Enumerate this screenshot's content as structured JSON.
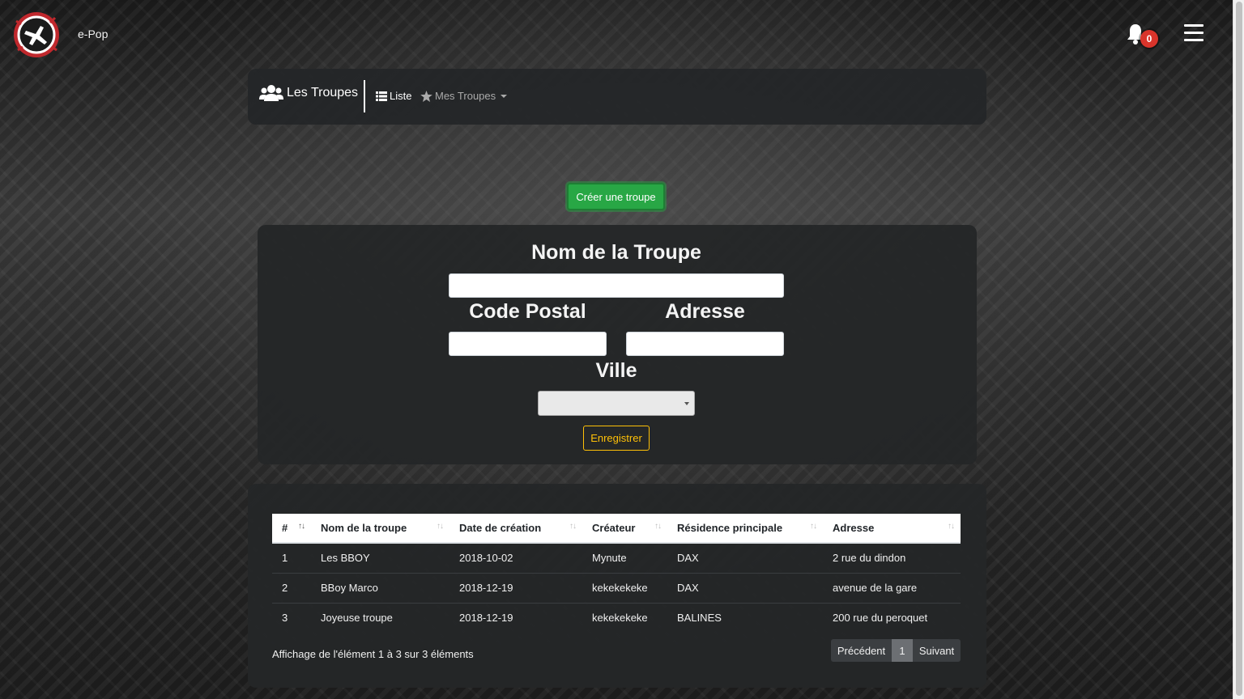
{
  "app": {
    "brand": "e-Pop",
    "notifications_count": "0"
  },
  "nav": {
    "title": "Les Troupes",
    "liste_label": "Liste",
    "mes_troupes_label": "Mes Troupes"
  },
  "actions": {
    "create_label": "Créer une troupe"
  },
  "form": {
    "nom_label": "Nom de la Troupe",
    "nom_value": "",
    "code_postal_label": "Code Postal",
    "code_postal_value": "",
    "adresse_label": "Adresse",
    "adresse_value": "",
    "ville_label": "Ville",
    "ville_value": "",
    "save_label": "Enregistrer"
  },
  "table": {
    "columns": [
      "#",
      "Nom de la troupe",
      "Date de création",
      "Créateur",
      "Résidence principale",
      "Adresse"
    ],
    "rows": [
      [
        "1",
        "Les BBOY",
        "2018-10-02",
        "Mynute",
        "DAX",
        "2 rue du dindon"
      ],
      [
        "2",
        "BBoy Marco",
        "2018-12-19",
        "kekekekeke",
        "DAX",
        "avenue de la gare"
      ],
      [
        "3",
        "Joyeuse troupe",
        "2018-12-19",
        "kekekekeke",
        "BALINES",
        "200 rue du peroquet"
      ]
    ],
    "info": "Affichage de l'élément 1 à 3 sur 3 éléments",
    "pagination": {
      "prev": "Précédent",
      "current": "1",
      "next": "Suivant"
    }
  },
  "colors": {
    "accent_green": "#28a745",
    "accent_yellow": "#ffc107",
    "badge_red": "#d9342b",
    "panel_bg": "#242628"
  }
}
